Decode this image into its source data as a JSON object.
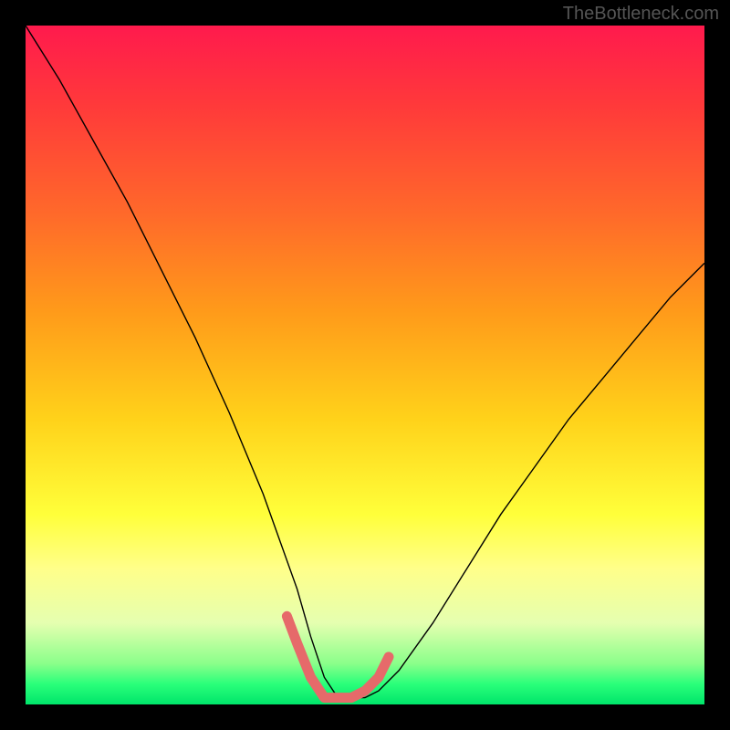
{
  "watermark": "TheBottleneck.com",
  "chart_data": {
    "type": "line",
    "title": "",
    "xlabel": "",
    "ylabel": "",
    "xlim": [
      0,
      100
    ],
    "ylim": [
      0,
      100
    ],
    "series": [
      {
        "name": "bottleneck-curve",
        "x": [
          0,
          5,
          10,
          15,
          20,
          25,
          30,
          35,
          40,
          42,
          44,
          46,
          48,
          50,
          52,
          55,
          60,
          65,
          70,
          75,
          80,
          85,
          90,
          95,
          100
        ],
        "y": [
          100,
          92,
          83,
          74,
          64,
          54,
          43,
          31,
          17,
          10,
          4,
          1,
          1,
          1,
          2,
          5,
          12,
          20,
          28,
          35,
          42,
          48,
          54,
          60,
          65
        ],
        "color": "#000000",
        "width": 1.4
      },
      {
        "name": "optimal-range",
        "x": [
          38.5,
          40,
          42,
          44,
          46,
          48,
          50,
          52,
          53.5
        ],
        "y": [
          13,
          9,
          4,
          1,
          1,
          1,
          2,
          4,
          7
        ],
        "color": "#e66a6a",
        "width": 11
      }
    ],
    "gradient_stops": [
      {
        "pos": 0,
        "color": "#ff1a4d"
      },
      {
        "pos": 12,
        "color": "#ff3a3a"
      },
      {
        "pos": 28,
        "color": "#ff6a2a"
      },
      {
        "pos": 42,
        "color": "#ff9a1a"
      },
      {
        "pos": 58,
        "color": "#ffd21a"
      },
      {
        "pos": 72,
        "color": "#ffff3a"
      },
      {
        "pos": 80,
        "color": "#ffff8a"
      },
      {
        "pos": 88,
        "color": "#e5ffb0"
      },
      {
        "pos": 94,
        "color": "#8aff8a"
      },
      {
        "pos": 97,
        "color": "#2aff7a"
      },
      {
        "pos": 100,
        "color": "#00e56a"
      }
    ]
  }
}
